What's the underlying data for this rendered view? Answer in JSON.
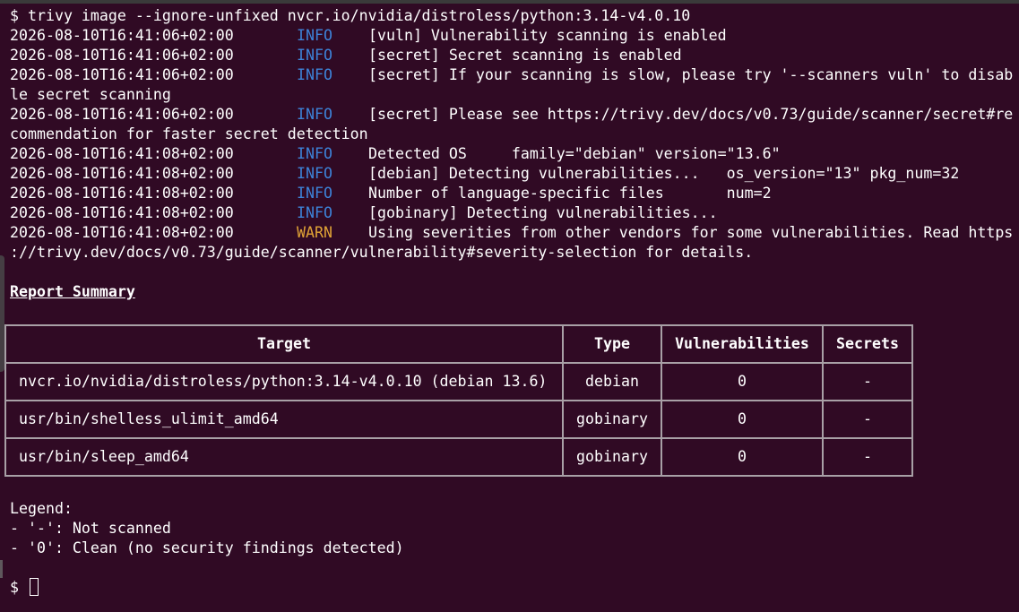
{
  "command": {
    "prompt": "$ ",
    "text": "trivy image --ignore-unfixed nvcr.io/nvidia/distroless/python:3.14-v4.0.10"
  },
  "log": [
    {
      "time": "2026-08-10T16:41:06+02:00",
      "level": "INFO",
      "msg": "[vuln] Vulnerability scanning is enabled"
    },
    {
      "time": "2026-08-10T16:41:06+02:00",
      "level": "INFO",
      "msg": "[secret] Secret scanning is enabled"
    },
    {
      "time": "2026-08-10T16:41:06+02:00",
      "level": "INFO",
      "msg": "[secret] If your scanning is slow, please try '--scanners vuln' to disab",
      "cont": "le secret scanning"
    },
    {
      "time": "2026-08-10T16:41:06+02:00",
      "level": "INFO",
      "msg": "[secret] Please see https://trivy.dev/docs/v0.73/guide/scanner/secret#re",
      "cont": "commendation for faster secret detection"
    },
    {
      "time": "2026-08-10T16:41:08+02:00",
      "level": "INFO",
      "msg": "Detected OS     family=\"debian\" version=\"13.6\""
    },
    {
      "time": "2026-08-10T16:41:08+02:00",
      "level": "INFO",
      "msg": "[debian] Detecting vulnerabilities...   os_version=\"13\" pkg_num=32"
    },
    {
      "time": "2026-08-10T16:41:08+02:00",
      "level": "INFO",
      "msg": "Number of language-specific files       num=2"
    },
    {
      "time": "2026-08-10T16:41:08+02:00",
      "level": "INFO",
      "msg": "[gobinary] Detecting vulnerabilities..."
    },
    {
      "time": "2026-08-10T16:41:08+02:00",
      "level": "WARN",
      "msg": "Using severities from other vendors for some vulnerabilities. Read https",
      "cont": "://trivy.dev/docs/v0.73/guide/scanner/vulnerability#severity-selection for details."
    }
  ],
  "report": {
    "heading": "Report Summary",
    "columns": [
      "Target",
      "Type",
      "Vulnerabilities",
      "Secrets"
    ],
    "rows": [
      [
        "nvcr.io/nvidia/distroless/python:3.14-v4.0.10 (debian 13.6)",
        "debian",
        "0",
        "-"
      ],
      [
        "usr/bin/shelless_ulimit_amd64",
        "gobinary",
        "0",
        "-"
      ],
      [
        "usr/bin/sleep_amd64",
        "gobinary",
        "0",
        "-"
      ]
    ]
  },
  "legend": {
    "title": "Legend:",
    "items": [
      "- '-': Not scanned",
      "- '0': Clean (no security findings detected)"
    ]
  },
  "final_prompt": "$ ",
  "colors": {
    "background": "#300a24",
    "info": "#3d83d9",
    "warn": "#e0a336",
    "text": "#ffffff"
  }
}
